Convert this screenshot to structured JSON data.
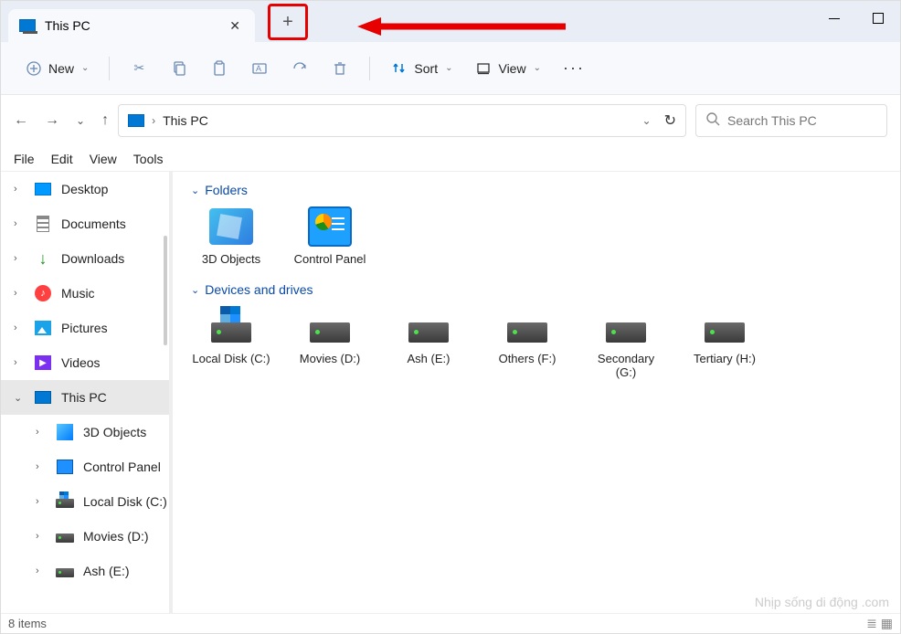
{
  "tab": {
    "title": "This PC"
  },
  "toolbar": {
    "new": "New",
    "sort": "Sort",
    "view": "View"
  },
  "address": {
    "path": "This PC"
  },
  "search": {
    "placeholder": "Search This PC"
  },
  "menubar": [
    "File",
    "Edit",
    "View",
    "Tools"
  ],
  "sidebar": [
    {
      "label": "Desktop",
      "icon": "desktop",
      "child": false
    },
    {
      "label": "Documents",
      "icon": "doc",
      "child": false
    },
    {
      "label": "Downloads",
      "icon": "down",
      "child": false
    },
    {
      "label": "Music",
      "icon": "music",
      "child": false
    },
    {
      "label": "Pictures",
      "icon": "pic",
      "child": false
    },
    {
      "label": "Videos",
      "icon": "vid",
      "child": false
    },
    {
      "label": "This PC",
      "icon": "pc",
      "child": false,
      "selected": true,
      "expanded": true
    },
    {
      "label": "3D Objects",
      "icon": "cube",
      "child": true
    },
    {
      "label": "Control Panel",
      "icon": "cpanel",
      "child": true
    },
    {
      "label": "Local Disk (C:)",
      "icon": "drive-win",
      "child": true
    },
    {
      "label": "Movies (D:)",
      "icon": "drive",
      "child": true
    },
    {
      "label": "Ash (E:)",
      "icon": "drive",
      "child": true
    }
  ],
  "sections": {
    "folders": {
      "header": "Folders",
      "items": [
        {
          "label": "3D Objects",
          "icon": "folder-3d"
        },
        {
          "label": "Control Panel",
          "icon": "cpanel-big"
        }
      ]
    },
    "drives": {
      "header": "Devices and drives",
      "items": [
        {
          "label": "Local Disk (C:)",
          "icon": "drive-win"
        },
        {
          "label": "Movies (D:)",
          "icon": "drive"
        },
        {
          "label": "Ash (E:)",
          "icon": "drive"
        },
        {
          "label": "Others (F:)",
          "icon": "drive"
        },
        {
          "label": "Secondary (G:)",
          "icon": "drive"
        },
        {
          "label": "Tertiary (H:)",
          "icon": "drive"
        }
      ]
    }
  },
  "status": {
    "count": "8 items"
  },
  "watermark": "Nhịp sống di động .com"
}
